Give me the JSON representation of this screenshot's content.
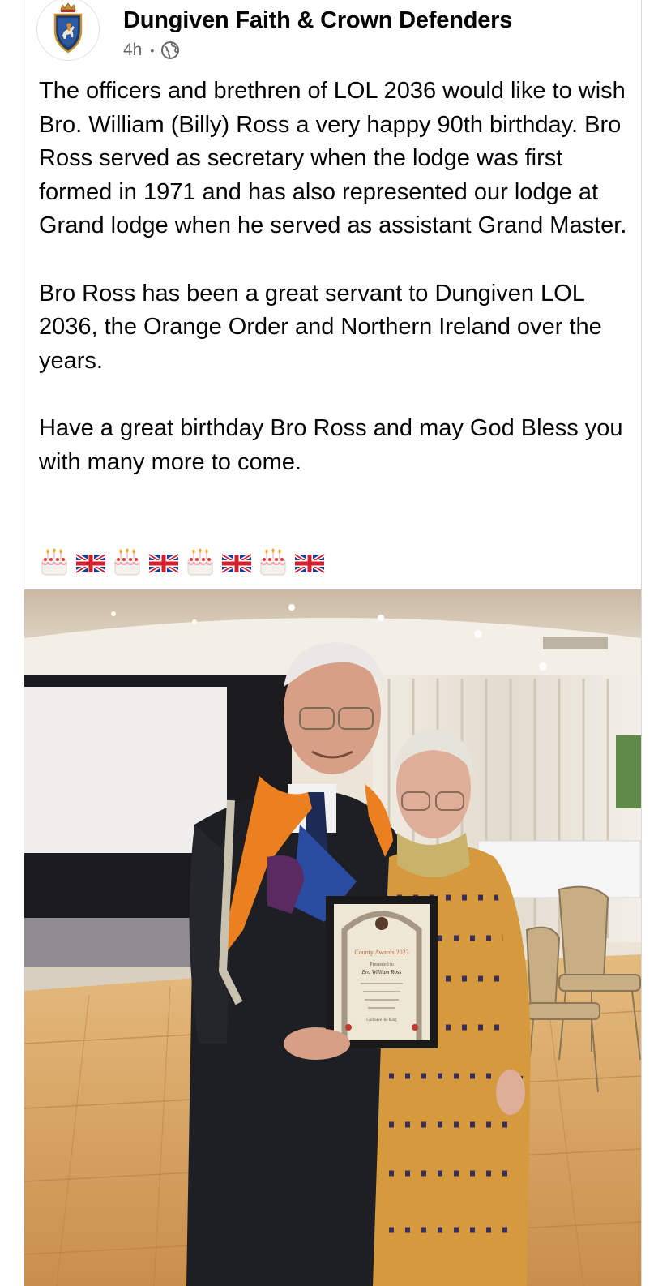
{
  "post": {
    "author": "Dungiven Faith & Crown Defenders",
    "time": "4h",
    "separator": "•",
    "privacy_icon": "globe-icon",
    "paragraphs": [
      "The officers and brethren of LOL 2036 would like to wish Bro. William (Billy) Ross a very happy 90th birthday. Bro Ross served as secretary when the lodge was first formed in 1971 and has also represented our lodge at Grand lodge when he served as assistant Grand Master.",
      "Bro Ross has been a great servant to Dungiven LOL 2036, the Orange Order and Northern Ireland over the years.",
      "Have a great birthday Bro Ross and may God Bless you with many more to come."
    ],
    "emojis": [
      "birthday-cake",
      "union-jack-flag",
      "birthday-cake",
      "union-jack-flag",
      "birthday-cake",
      "union-jack-flag",
      "birthday-cake",
      "union-jack-flag"
    ]
  },
  "photo": {
    "certificate": {
      "heading": "County Awards 2023",
      "presented_to": "Presented to",
      "recipient": "Bro William Ross",
      "footer": "God save the King"
    }
  },
  "colors": {
    "text": "#050505",
    "secondary": "#65676b",
    "sash_orange": "#f08a24",
    "sash_purple": "#5b2a63",
    "floor": "#d9a866"
  }
}
